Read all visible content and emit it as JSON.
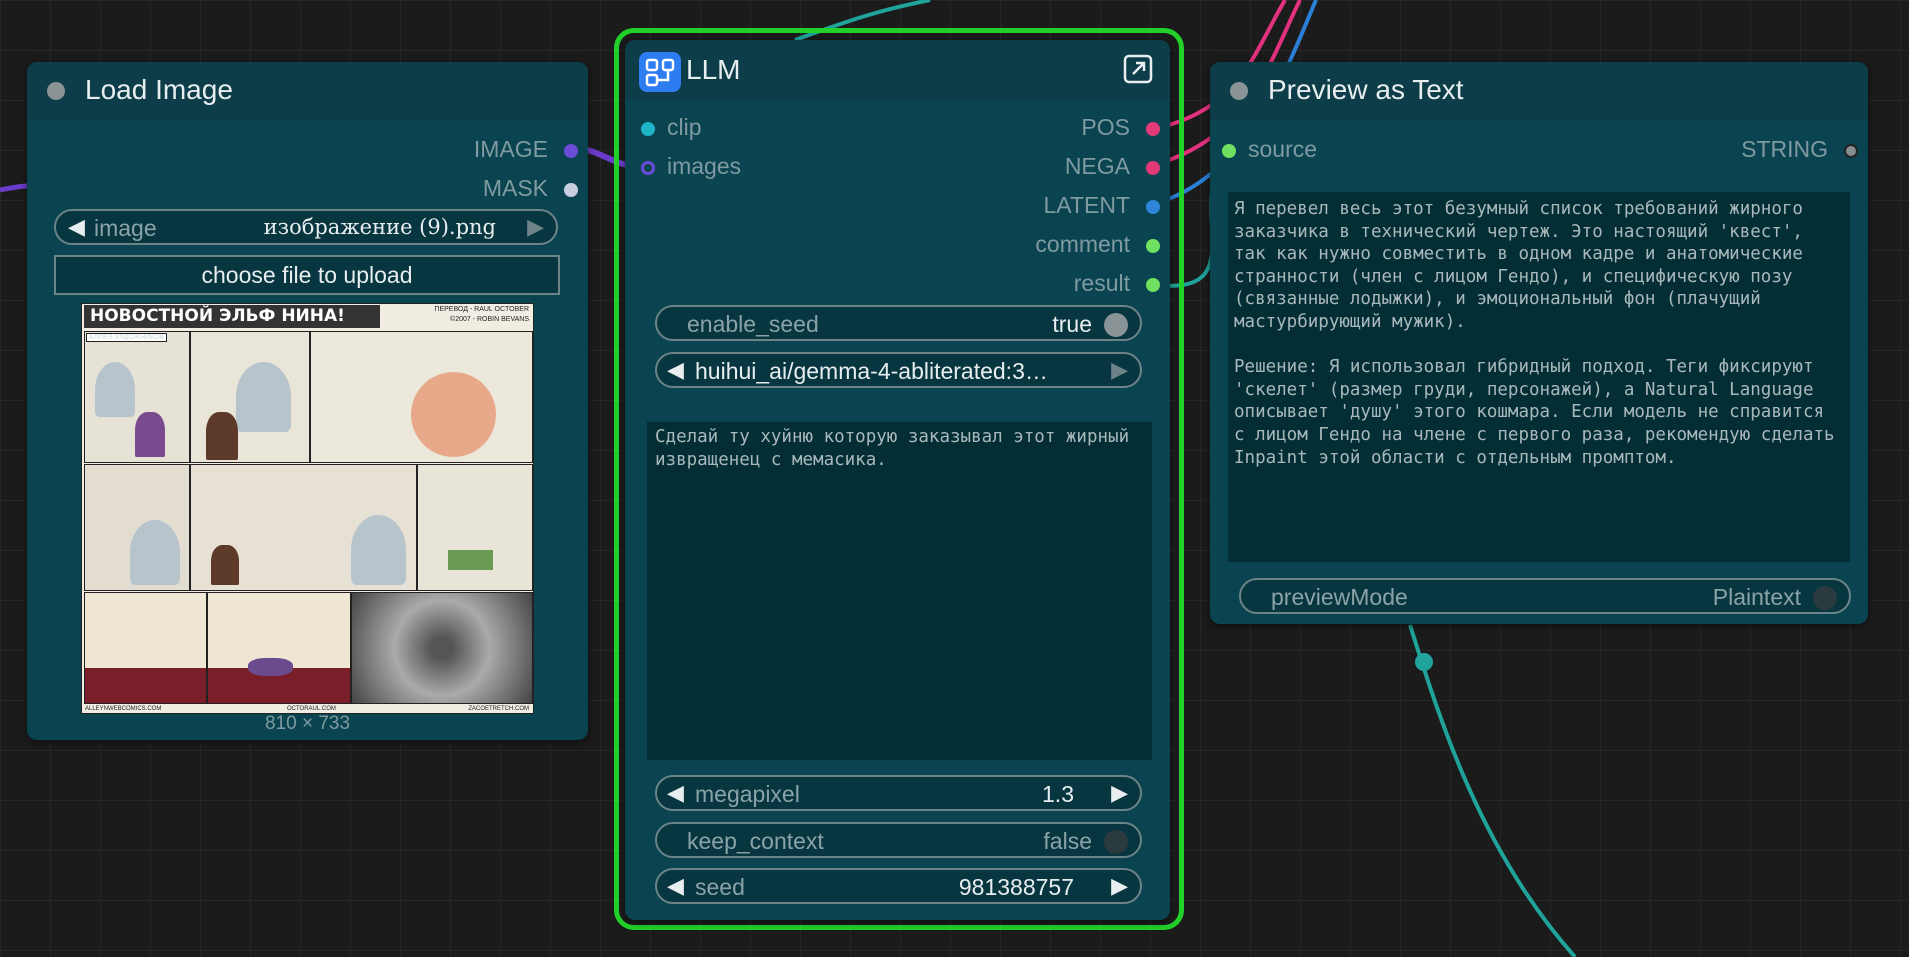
{
  "colors": {
    "canvas_bg": "#1b1b1b",
    "node_bg": "#0a4450",
    "node_header": "#0c3d48",
    "selected_outline": "#21d12a",
    "wire_teal": "#1fa39a",
    "wire_pink": "#e2327f",
    "wire_blue": "#2b7fd6",
    "wire_purple": "#6b3cc9",
    "port_image": "#6b4cd6",
    "port_mask": "#c9cde0",
    "port_clip": "#1fb5c9",
    "port_pos_nega": "#e23a78",
    "port_latent": "#2e86d9",
    "port_string": "#6fe060",
    "port_string_out": "#888f92"
  },
  "load_image": {
    "title": "Load Image",
    "outputs": [
      "IMAGE",
      "MASK"
    ],
    "image_widget": {
      "label": "image",
      "value": "изображение (9).png"
    },
    "upload_button": "choose file to upload",
    "size_label": "810 × 733",
    "comic": {
      "title": "НОВОСТНОЙ ЭЛЬФ НИНА!",
      "credit_1": "ПЕРЕВОД - RAUL OCTOBER",
      "credit_2": "©2007 - ROBIN BEVANS",
      "name_tag": "АЛЛЕЯ ХУДОЖНИКОВ",
      "footer_left": "ALLEYNWEBCOMICS.COM",
      "footer_mid": "OCTORAUL.COM",
      "footer_right": "ZACOETRETCH.COM"
    }
  },
  "llm": {
    "title": "LLM",
    "inputs": [
      "clip",
      "images"
    ],
    "outputs": [
      "POS",
      "NEGA",
      "LATENT",
      "comment",
      "result"
    ],
    "enable_seed": {
      "label": "enable_seed",
      "value": "true"
    },
    "model": "huihui_ai/gemma-4-abliterated:3…",
    "prompt": "Сделай ту хуйню которую заказывал этот жирный извращенец с мемасика.",
    "megapixel": {
      "label": "megapixel",
      "value": "1.3"
    },
    "keep_context": {
      "label": "keep_context",
      "value": "false"
    },
    "seed": {
      "label": "seed",
      "value": "981388757"
    }
  },
  "preview_text": {
    "title": "Preview as Text",
    "input": "source",
    "output": "STRING",
    "text": "Я перевел весь этот безумный список требований жирного заказчика в технический чертеж. Это настоящий 'квест', так как нужно совместить в одном кадре и анатомические странности (член с лицом Гендо), и специфическую позу (связанные лодыжки), и эмоциональный фон (плачущий мастурбирующий мужик).\n\nРешение: Я использовал гибридный подход. Теги фиксируют 'скелет' (размер груди, персонажей), а Natural Language описывает 'душу' этого кошмара. Если модель не справится с лицом Гендо на члене с первого раза, рекомендую сделать Inpaint этой области с отдельным промптом.",
    "preview_mode": {
      "label": "previewMode",
      "value": "Plaintext"
    }
  }
}
